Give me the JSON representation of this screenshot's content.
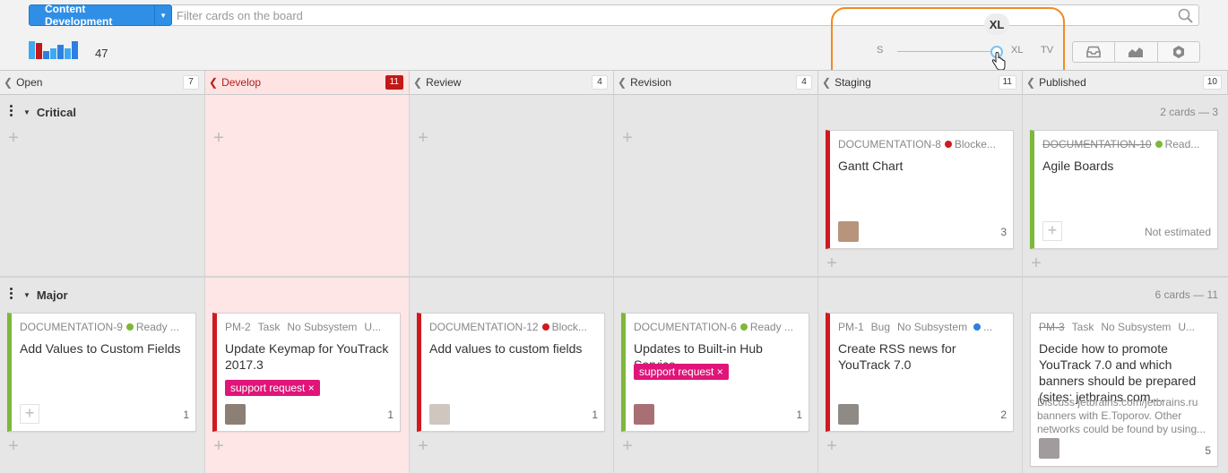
{
  "header": {
    "project_label": "Content Development",
    "filter_placeholder": "Filter cards on the board",
    "card_count": "47",
    "size_bubble": "XL",
    "size_min": "S",
    "size_xl": "XL",
    "size_tv": "TV"
  },
  "columns": [
    {
      "name": "Open",
      "count": "7"
    },
    {
      "name": "Develop",
      "count": "11"
    },
    {
      "name": "Review",
      "count": "4"
    },
    {
      "name": "Revision",
      "count": "4"
    },
    {
      "name": "Staging",
      "count": "11"
    },
    {
      "name": "Published",
      "count": "10"
    }
  ],
  "swimlanes": [
    {
      "name": "Critical",
      "info": "2 cards — 3"
    },
    {
      "name": "Major",
      "info": "6 cards — 11"
    }
  ],
  "critical_cards": [
    {
      "id": "DOCUMENTATION-8",
      "state": "Blocke...",
      "state_color": "#cf1a20",
      "title": "Gantt Chart",
      "num": "3"
    },
    {
      "id": "DOCUMENTATION-10",
      "state": "Read...",
      "state_color": "#7cb83a",
      "title": "Agile Boards",
      "estimate": "Not estimated"
    }
  ],
  "major_cards": [
    {
      "id": "DOCUMENTATION-9",
      "state": "Ready ...",
      "state_color": "#7cb83a",
      "title": "Add Values to Custom Fields",
      "num": "1"
    },
    {
      "id": "PM-2",
      "type": "Task",
      "subsystem": "No Subsystem",
      "extra": "U...",
      "title": "Update Keymap for YouTrack 2017.3",
      "tag": "support request ×",
      "num": "1"
    },
    {
      "id": "DOCUMENTATION-12",
      "state": "Block...",
      "state_color": "#cf1a20",
      "title": "Add values to custom fields",
      "num": "1"
    },
    {
      "id": "DOCUMENTATION-6",
      "state": "Ready ...",
      "state_color": "#7cb83a",
      "title": "Updates to Built-in Hub Service",
      "tag": "support request ×",
      "num": "1"
    },
    {
      "id": "PM-1",
      "type": "Bug",
      "subsystem": "No Subsystem",
      "extra": "...",
      "extra_color": "#2f7fe0",
      "title": "Create RSS news for YouTrack 7.0",
      "num": "2"
    },
    {
      "id": "PM-3",
      "type": "Task",
      "subsystem": "No Subsystem",
      "extra": "U...",
      "title": "Decide how to promote YouTrack 7.0 and which banners should be prepared (sites: jetbrains.com,...",
      "desc": "Discuss jetbrains.com/jetbrains.ru banners with E.Toporov. Other networks could be found by using...",
      "num": "5"
    }
  ],
  "colors": {
    "accent": "#2f8fe6",
    "blocked": "#cf1a20",
    "ready": "#7cb83a",
    "tag": "#e0157a",
    "wip_exceeded": "#ffe6e6",
    "highlight": "#f08a24"
  },
  "icons": [
    "search-icon",
    "inbox-icon",
    "chart-icon",
    "settings-icon",
    "hand-cursor-icon",
    "more-icon",
    "collapse-icon",
    "add-icon"
  ]
}
